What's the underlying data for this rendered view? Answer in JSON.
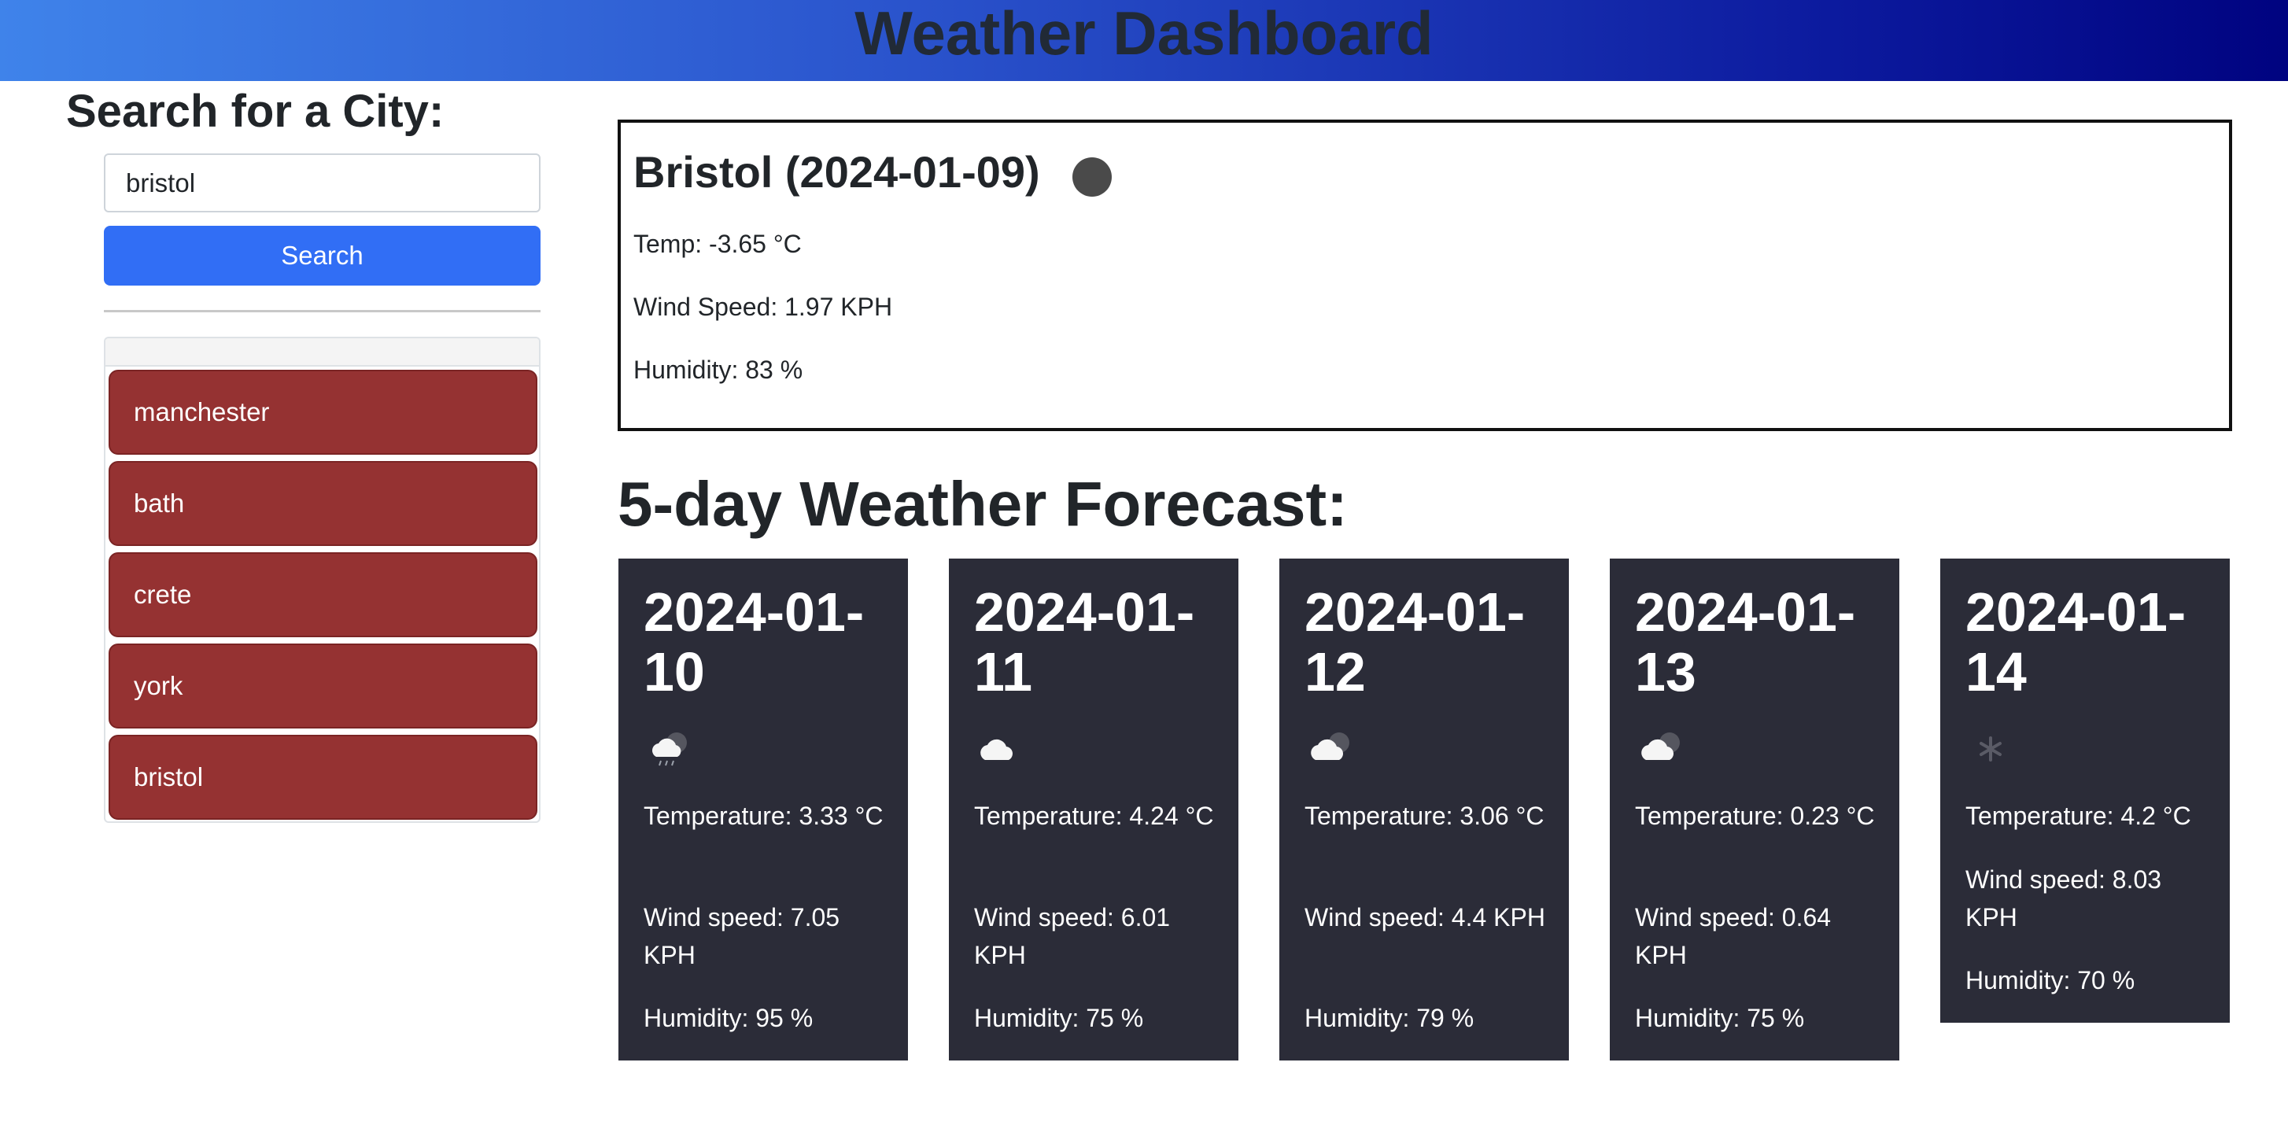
{
  "header": {
    "title": "Weather Dashboard"
  },
  "search": {
    "title": "Search for a City:",
    "input_value": "bristol",
    "button_label": "Search"
  },
  "history": {
    "cities": [
      "manchester",
      "bath",
      "crete",
      "york",
      "bristol"
    ]
  },
  "current": {
    "title": "Bristol (2024-01-09)",
    "temp": "Temp: -3.65 °C",
    "wind": "Wind Speed: 1.97 KPH",
    "humidity": "Humidity: 83 %"
  },
  "forecast": {
    "title": "5-day Weather Forecast:",
    "days": [
      {
        "date": "2024-01-10",
        "icon": "rain-cloud-icon",
        "temp": "Temperature: 3.33 °C",
        "wind": "Wind speed: 7.05 KPH",
        "humidity": "Humidity: 95 %"
      },
      {
        "date": "2024-01-11",
        "icon": "cloud-icon",
        "temp": "Temperature: 4.24 °C",
        "wind": "Wind speed: 6.01 KPH",
        "humidity": "Humidity: 75 %"
      },
      {
        "date": "2024-01-12",
        "icon": "cloudy-night-icon",
        "temp": "Temperature: 3.06 °C",
        "wind": "Wind speed: 4.4 KPH",
        "humidity": "Humidity: 79 %"
      },
      {
        "date": "2024-01-13",
        "icon": "cloudy-night-icon",
        "temp": "Temperature: 0.23 °C",
        "wind": "Wind speed: 0.64 KPH",
        "humidity": "Humidity: 75 %"
      },
      {
        "date": "2024-01-14",
        "icon": "snowflake-icon",
        "temp": "Temperature: 4.2 °C",
        "wind": "Wind speed: 8.03 KPH",
        "humidity": "Humidity: 70 %"
      }
    ]
  },
  "colors": {
    "header_gradient": [
      "#3f83ea",
      "#000380"
    ],
    "search_button": "#316ef5",
    "city_button": "#953232",
    "forecast_card": "#2b2c38"
  }
}
